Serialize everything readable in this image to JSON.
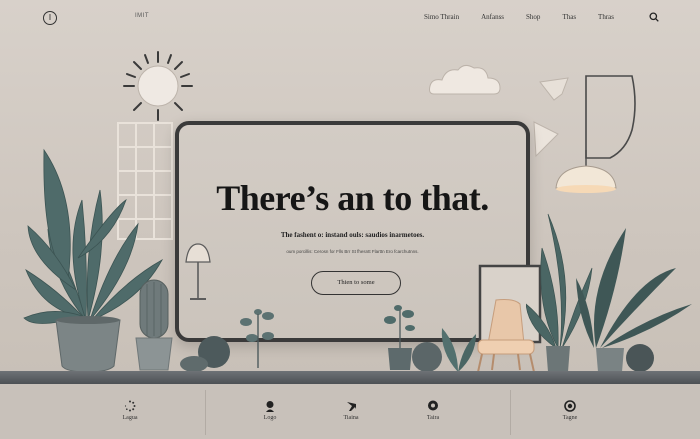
{
  "nav": {
    "logo_glyph": "I",
    "brand": "IMIT",
    "links": [
      "Simo Thrain",
      "Anfanss",
      "Shop",
      "Thas",
      "Thras"
    ],
    "search_icon": "search-icon"
  },
  "hero": {
    "headline": "There’s an to that.",
    "subline": "The fashent o: instand ouls: saudios inarmetoes.",
    "small_text": "oum porcillis: Cerosn for Flls Brr St fhesntt Flarttn Ero fcarchutnns.",
    "cta_label": "Thien to some"
  },
  "footer": {
    "items": [
      {
        "label": "Lagua",
        "icon": "spinner-icon"
      },
      {
        "label": "Logo",
        "icon": "user-icon"
      },
      {
        "label": "Tiaina",
        "icon": "plane-icon"
      },
      {
        "label": "Taira",
        "icon": "badge-icon"
      },
      {
        "label": "Tagne",
        "icon": "ring-icon"
      }
    ]
  },
  "colors": {
    "background": "#d8d1ca",
    "screen": "#cfc8c0",
    "border": "#3a3a3a",
    "plant": "#4f6b6a",
    "pot": "#6c7677",
    "lamp": "#f0e3d0"
  }
}
